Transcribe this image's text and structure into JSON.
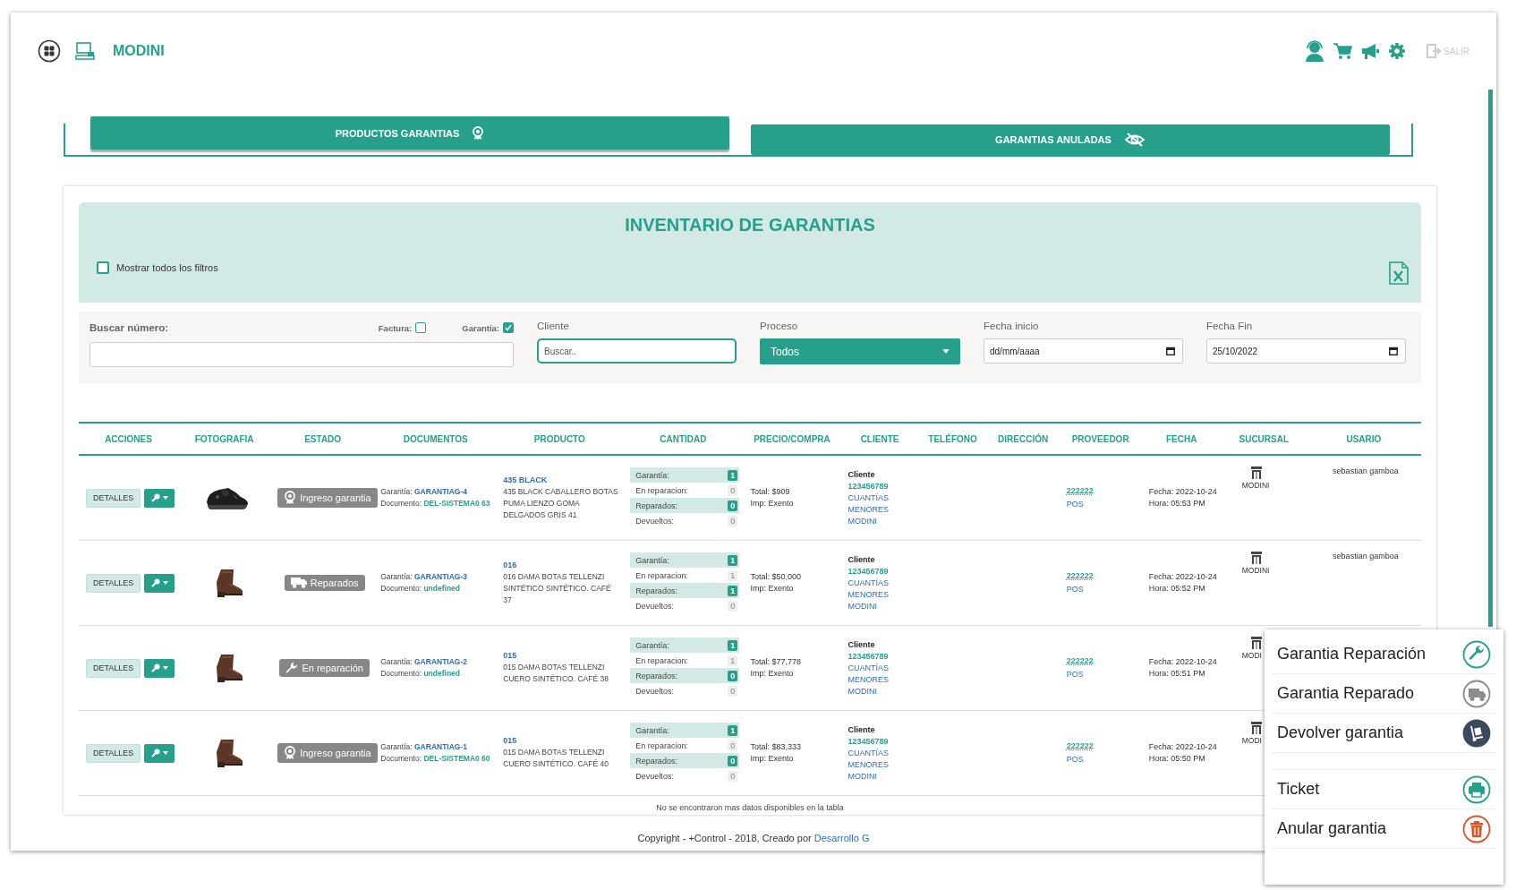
{
  "header": {
    "brand": "MODINI",
    "logout": "SALIR"
  },
  "tabs": [
    {
      "label": "PRODUCTOS GARANTIAS",
      "selected": true,
      "kind": "award"
    },
    {
      "label": "GARANTIAS ANULADAS",
      "selected": false,
      "kind": "hidden"
    }
  ],
  "panel": {
    "title": "INVENTARIO DE GARANTIAS",
    "show_filters": {
      "label": "Mostrar todos los filtros",
      "checked": false
    }
  },
  "filters": {
    "number": {
      "label": "Buscar número:",
      "factura": {
        "label": "Factura:",
        "checked": false
      },
      "garantia": {
        "label": "Garantía:",
        "checked": true
      }
    },
    "cliente": {
      "label": "Cliente",
      "placeholder": "Buscar.."
    },
    "proceso": {
      "label": "Proceso",
      "value": "Todos"
    },
    "fecha_inicio": {
      "label": "Fecha inicio",
      "placeholder": "dd/mm/aaaa"
    },
    "fecha_fin": {
      "label": "Fecha Fin",
      "value": "25/10/2022"
    }
  },
  "table": {
    "columns": [
      "ACCIONES",
      "FOTOGRAFIA",
      "ESTADO",
      "DOCUMENTOS",
      "PRODUCTO",
      "CANTIDAD",
      "PRECIO/COMPRA",
      "CLIENTE",
      "TELÉFONO",
      "DIRECCIÓN",
      "PROVEEDOR",
      "FECHA",
      "SUCURSAL",
      "USARIO"
    ],
    "rows": [
      {
        "details": "DETALLES",
        "status": {
          "label": "Ingreso garantia",
          "kind": "award"
        },
        "garantia_label": "Garantía:",
        "garantia": "GARANTIAG-4",
        "documento_label": "Documento:",
        "documento": "DEL-SISTEMA0 63",
        "product_code": "435 BLACK",
        "product": "435 BLACK CABALLERO BOTAS PUMA   LIENZO GOMA DELGADOS  GRIS 41",
        "quantities": [
          {
            "label": "Garantía:",
            "count": "1",
            "highlight": true
          },
          {
            "label": "En reparacion:",
            "count": "0",
            "highlight": false
          },
          {
            "label": "Reparados:",
            "count": "0",
            "highlight": true
          },
          {
            "label": "Devueltos:",
            "count": "0",
            "highlight": false
          }
        ],
        "total": "Total: $909",
        "tax": "Imp: Exento",
        "client_label": "Cliente",
        "client_id": "123456789",
        "client_name": "CUANTÍAS MENORES MODINI",
        "supplier": "222222",
        "supplier_type": "POS",
        "date": "Fecha: 2022-10-24",
        "time": "Hora: 05:53 PM",
        "branch": "MODINI",
        "user": "sebastian gamboa"
      },
      {
        "details": "DETALLES",
        "status": {
          "label": "Reparados",
          "kind": "truck"
        },
        "garantia_label": "Garantía:",
        "garantia": "GARANTIAG-3",
        "documento_label": "Documento:",
        "documento": "undefined",
        "product_code": "016",
        "product": "016 DAMA BOTAS TELLENZI SINTÉTICO SINTÉTICO.  CAFÉ 37",
        "quantities": [
          {
            "label": "Garantía:",
            "count": "1",
            "highlight": true
          },
          {
            "label": "En reparacion:",
            "count": "1",
            "highlight": false
          },
          {
            "label": "Reparados:",
            "count": "1",
            "highlight": true
          },
          {
            "label": "Devueltos:",
            "count": "0",
            "highlight": false
          }
        ],
        "total": "Total: $50,000",
        "tax": "Imp: Exento",
        "client_label": "Cliente",
        "client_id": "123456789",
        "client_name": "CUANTÍAS MENORES MODINI",
        "supplier": "222222",
        "supplier_type": "POS",
        "date": "Fecha: 2022-10-24",
        "time": "Hora: 05:52 PM",
        "branch": "MODINI",
        "user": "sebastian gamboa"
      },
      {
        "details": "DETALLES",
        "status": {
          "label": "En reparación",
          "kind": "wrench"
        },
        "garantia_label": "Garantía:",
        "garantia": "GARANTIAG-2",
        "documento_label": "Documento:",
        "documento": "undefined",
        "product_code": "015",
        "product": "015 DAMA BOTAS TELLENZI CUERO SINTÉTICO.  CAFÉ 38",
        "quantities": [
          {
            "label": "Garantía:",
            "count": "1",
            "highlight": true
          },
          {
            "label": "En reparacion:",
            "count": "1",
            "highlight": false
          },
          {
            "label": "Reparados:",
            "count": "0",
            "highlight": true
          },
          {
            "label": "Devueltos:",
            "count": "0",
            "highlight": false
          }
        ],
        "total": "Total: $77,778",
        "tax": "Imp: Exento",
        "client_label": "Cliente",
        "client_id": "123456789",
        "client_name": "CUANTÍAS MENORES MODINI",
        "supplier": "222222",
        "supplier_type": "POS",
        "date": "Fecha: 2022-10-24",
        "time": "Hora: 05:51 PM",
        "branch": "MODI"
      },
      {
        "details": "DETALLES",
        "status": {
          "label": "Ingreso garantia",
          "kind": "award"
        },
        "garantia_label": "Garantía:",
        "garantia": "GARANTIAG-1",
        "documento_label": "Documento:",
        "documento": "DEL-SISTEMA0 60",
        "product_code": "015",
        "product": "015 DAMA BOTAS TELLENZI CUERO SINTÉTICO.  CAFÉ 40",
        "quantities": [
          {
            "label": "Garantía:",
            "count": "1",
            "highlight": true
          },
          {
            "label": "En reparacion:",
            "count": "0",
            "highlight": false
          },
          {
            "label": "Reparados:",
            "count": "0",
            "highlight": true
          },
          {
            "label": "Devueltos:",
            "count": "0",
            "highlight": false
          }
        ],
        "total": "Total: $83,333",
        "tax": "Imp: Exento",
        "client_label": "Cliente",
        "client_id": "123456789",
        "client_name": "CUANTÍAS MENORES MODINI",
        "supplier": "222222",
        "supplier_type": "POS",
        "date": "Fecha: 2022-10-24",
        "time": "Hora: 05:50 PM",
        "branch": "MODI"
      }
    ],
    "empty_message": "No se encontraron mas datos disponibles en la tabla"
  },
  "footer": {
    "text": "Copyright - +Control - 2018, Creado por",
    "link": "Desarrollo G"
  },
  "menu": {
    "groups": [
      [
        {
          "label": "Garantia Reparación",
          "kind": "wrench",
          "color": "#26a08b"
        },
        {
          "label": "Garantia Reparado",
          "kind": "truck",
          "color": "#8c8c8c"
        },
        {
          "label": "Devolver garantia",
          "kind": "dolly",
          "color": "#3b4a5f"
        }
      ],
      [
        {
          "label": "Ticket",
          "kind": "printer",
          "color": "#26a08b"
        },
        {
          "label": "Anular garantia",
          "kind": "trash",
          "color": "#d9572b"
        }
      ]
    ]
  }
}
